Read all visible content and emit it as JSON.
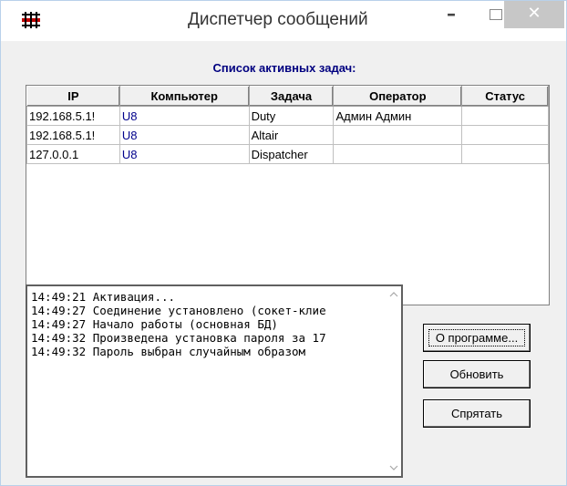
{
  "window": {
    "title": "Диспетчер сообщений",
    "minimize_glyph": "–",
    "close_glyph": "✕",
    "icon": "app-icon"
  },
  "tasks": {
    "caption": "Список активных задач:",
    "columns": [
      "IP",
      "Компьютер",
      "Задача",
      "Оператор",
      "Статус"
    ],
    "rows": [
      {
        "ip": "192.168.5.1!",
        "computer": "U8",
        "task": "Duty",
        "operator": "Админ Админ",
        "status": ""
      },
      {
        "ip": "192.168.5.1!",
        "computer": "U8",
        "task": "Altair",
        "operator": "",
        "status": ""
      },
      {
        "ip": "127.0.0.1",
        "computer": "U8",
        "task": "Dispatcher",
        "operator": "",
        "status": ""
      }
    ]
  },
  "log": {
    "lines": [
      "14:49:21 Активация...",
      "14:49:27 Соединение установлено (сокет-клие",
      "14:49:27 Начало работы  (основная БД)",
      "14:49:32 Произведена установка пароля за 17",
      "14:49:32 Пароль выбран случайным образом"
    ]
  },
  "buttons": {
    "about": "О программе...",
    "refresh": "Обновить",
    "hide": "Спрятать"
  },
  "colors": {
    "caption": "#000080",
    "computer_text": "#00008b",
    "close_button": "#c7c7c7"
  }
}
